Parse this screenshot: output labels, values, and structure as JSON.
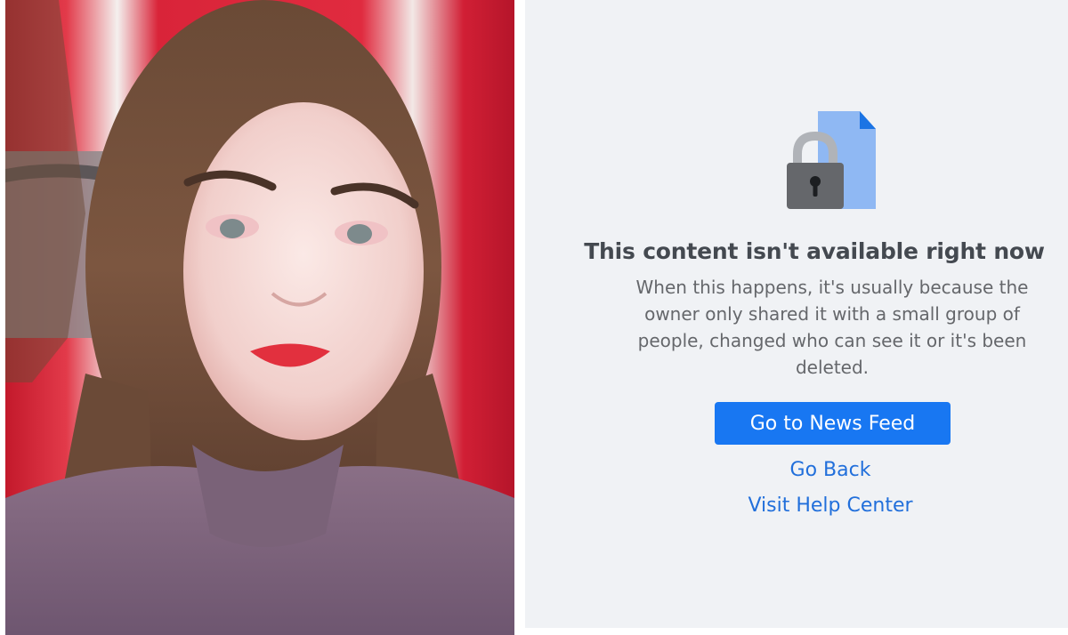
{
  "error": {
    "title": "This content isn't available right now",
    "message": "When this happens, it's usually because the owner only shared it with a small group of people, changed who can see it or it's been deleted.",
    "icon": "locked-document-icon"
  },
  "actions": {
    "news_feed_label": "Go to News Feed",
    "go_back_label": "Go Back",
    "help_center_label": "Visit Help Center"
  },
  "colors": {
    "accent": "#1877f2",
    "link": "#216fdb",
    "panel_background": "#f0f2f5",
    "title": "#444950",
    "body": "#65676b"
  }
}
